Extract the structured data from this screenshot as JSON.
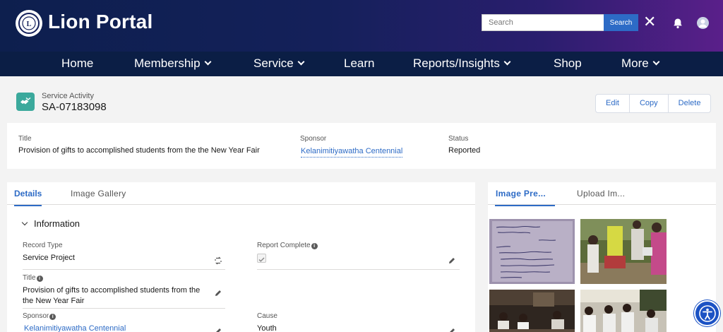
{
  "header": {
    "brand": "Lion Portal",
    "logo_text": "LIONS",
    "search_placeholder": "Search",
    "search_button": "Search"
  },
  "nav": {
    "items": [
      {
        "label": "Home",
        "dropdown": false
      },
      {
        "label": "Membership",
        "dropdown": true
      },
      {
        "label": "Service",
        "dropdown": true
      },
      {
        "label": "Learn",
        "dropdown": false
      },
      {
        "label": "Reports/Insights",
        "dropdown": true
      },
      {
        "label": "Shop",
        "dropdown": false
      },
      {
        "label": "More",
        "dropdown": true
      }
    ]
  },
  "record": {
    "object_type": "Service Activity",
    "record_id": "SA-07183098",
    "actions": [
      "Edit",
      "Copy",
      "Delete"
    ]
  },
  "highlights": {
    "title_label": "Title",
    "title_value": "Provision of gifts to accomplished students from the the New Year Fair",
    "sponsor_label": "Sponsor",
    "sponsor_value": "Kelanimitiyawatha Centennial",
    "status_label": "Status",
    "status_value": "Reported"
  },
  "details": {
    "tabs": [
      "Details",
      "Image Gallery"
    ],
    "section_title": "Information",
    "fields": {
      "record_type_label": "Record Type",
      "record_type_value": "Service Project",
      "report_complete_label": "Report Complete",
      "report_complete_checked": true,
      "title_label": "Title",
      "title_value_line1": "Provision of gifts to accomplished students from the",
      "title_value_line2": "the New Year Fair",
      "sponsor_label": "Sponsor",
      "sponsor_value": "Kelanimitiyawatha Centennial",
      "cause_label": "Cause",
      "cause_value": "Youth"
    }
  },
  "image_panel": {
    "tabs": [
      "Image Pre...",
      "Upload Im..."
    ]
  },
  "colors": {
    "accent": "#2d6bc6",
    "nav_bg": "#0b1e45",
    "record_icon": "#3ba99c",
    "a11y_button": "#1b52c4"
  }
}
